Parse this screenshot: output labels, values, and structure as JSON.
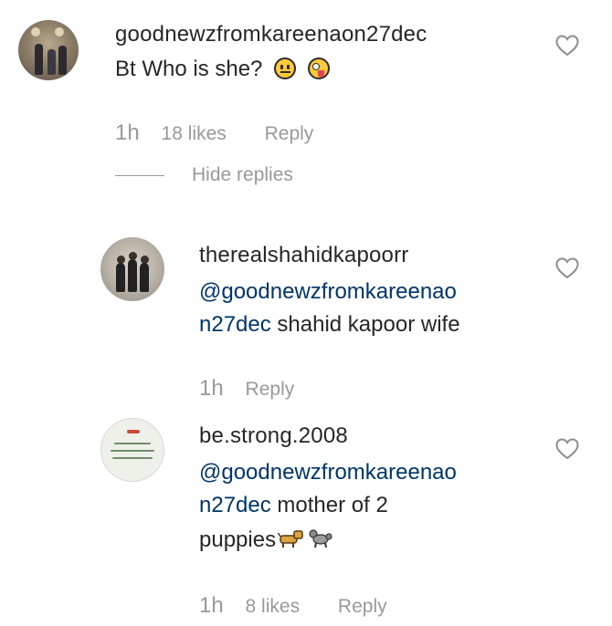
{
  "comments": [
    {
      "username": "goodnewzfromkareenaon27dec",
      "text": "Bt Who is she?",
      "emojis": [
        "neutral-face-emoji",
        "zany-face-emoji"
      ],
      "time": "1h",
      "likes": "18 likes",
      "reply_label": "Reply",
      "hide_replies_label": "Hide replies"
    }
  ],
  "replies": [
    {
      "username": "therealshahidkapoorr",
      "mention_line1": "@goodnewzfromkareenao",
      "mention_line2": "n27dec",
      "text": " shahid kapoor wife",
      "time": "1h",
      "reply_label": "Reply"
    },
    {
      "username": "be.strong.2008",
      "mention_line1": "@goodnewzfromkareenao",
      "mention_line2": "n27dec",
      "text_line2": " mother of 2",
      "text_line3": "puppies",
      "emojis": [
        "dog-emoji",
        "poodle-emoji"
      ],
      "time": "1h",
      "likes": "8 likes",
      "reply_label": "Reply"
    }
  ],
  "colors": {
    "text": "#262626",
    "mention": "#003569",
    "meta": "#999999",
    "background": "#ffffff"
  },
  "icons": [
    "heart-outline-icon"
  ]
}
